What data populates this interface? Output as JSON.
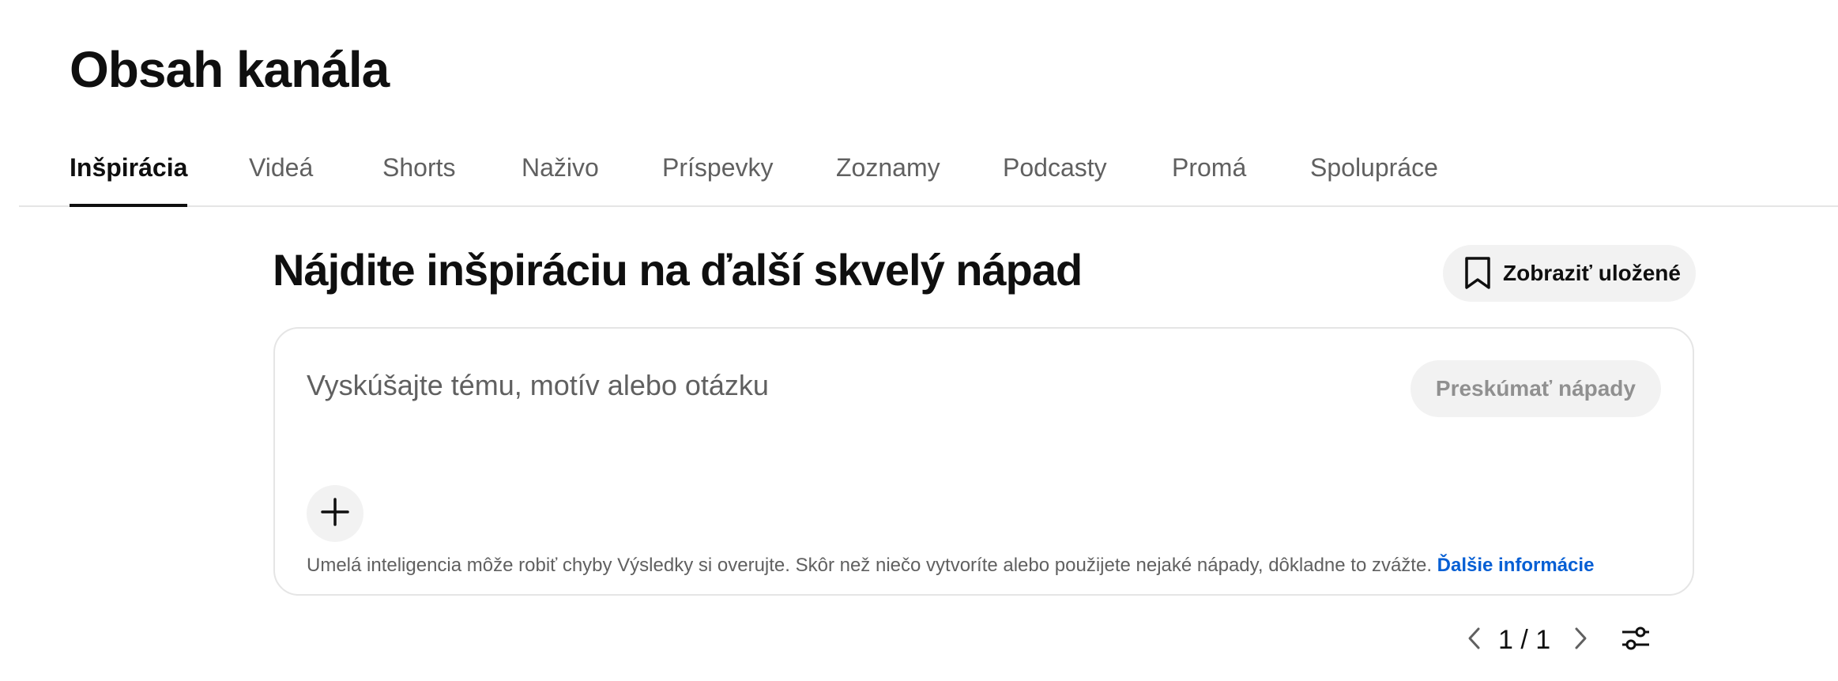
{
  "page": {
    "title": "Obsah kanála"
  },
  "tabs": [
    {
      "label": "Inšpirácia",
      "active": true
    },
    {
      "label": "Videá",
      "active": false
    },
    {
      "label": "Shorts",
      "active": false
    },
    {
      "label": "Naživo",
      "active": false
    },
    {
      "label": "Príspevky",
      "active": false
    },
    {
      "label": "Zoznamy",
      "active": false
    },
    {
      "label": "Podcasty",
      "active": false
    },
    {
      "label": "Promá",
      "active": false
    },
    {
      "label": "Spolupráce",
      "active": false
    }
  ],
  "inspiration": {
    "heading": "Nájdite inšpiráciu na ďalší skvelý nápad",
    "saved_button_label": "Zobraziť uložené",
    "saved_icon": "bookmark-icon",
    "prompt": {
      "value": "",
      "placeholder": "Vyskúšajte tému, motív alebo otázku"
    },
    "explore_button_label": "Preskúmať nápady",
    "add_icon": "plus-icon",
    "disclaimer_text": "Umelá inteligencia môže robiť chyby Výsledky si overujte. Skôr než niečo vytvoríte alebo použijete nejaké nápady, dôkladne to zvážte.",
    "disclaimer_link": "Ďalšie informácie"
  },
  "pagination": {
    "text": "1 / 1",
    "prev_icon": "chevron-left-icon",
    "next_icon": "chevron-right-icon",
    "filter_icon": "filter-sliders-icon"
  },
  "colors": {
    "text_primary": "#0f0f0f",
    "text_secondary": "#606060",
    "button_bg": "#f2f2f2",
    "link": "#065fd4",
    "border": "#e5e5e5"
  }
}
